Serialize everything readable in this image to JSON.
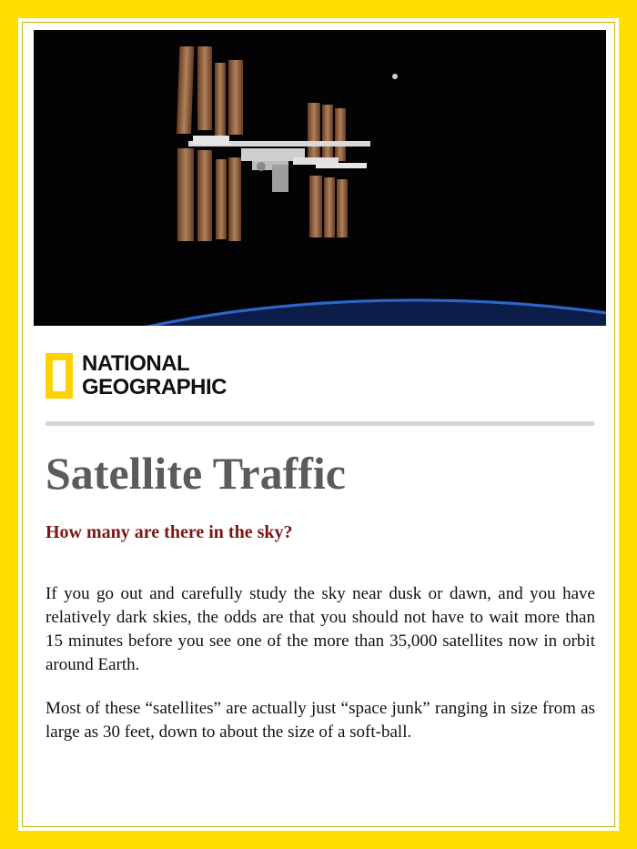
{
  "brand": {
    "line1": "NATIONAL",
    "line2": "GEOGRAPHIC",
    "accent_color": "#ffde00"
  },
  "article": {
    "title": "Satellite Traffic",
    "subtitle": "How many are there in the sky?",
    "paragraphs": [
      "If you go out and carefully study the sky near dusk or dawn, and you have relatively dark skies, the odds are that you should not have to wait more than 15 minutes before you see one of the more than 35,000 satellites now in orbit around Earth.",
      "Most of these “satellites” are actually just “space junk” ranging in size from as large as 30 feet, down to about the size of a soft-ball."
    ]
  },
  "colors": {
    "title": "#5b5b5b",
    "subtitle": "#7a1614",
    "divider": "#d6d6d6"
  }
}
